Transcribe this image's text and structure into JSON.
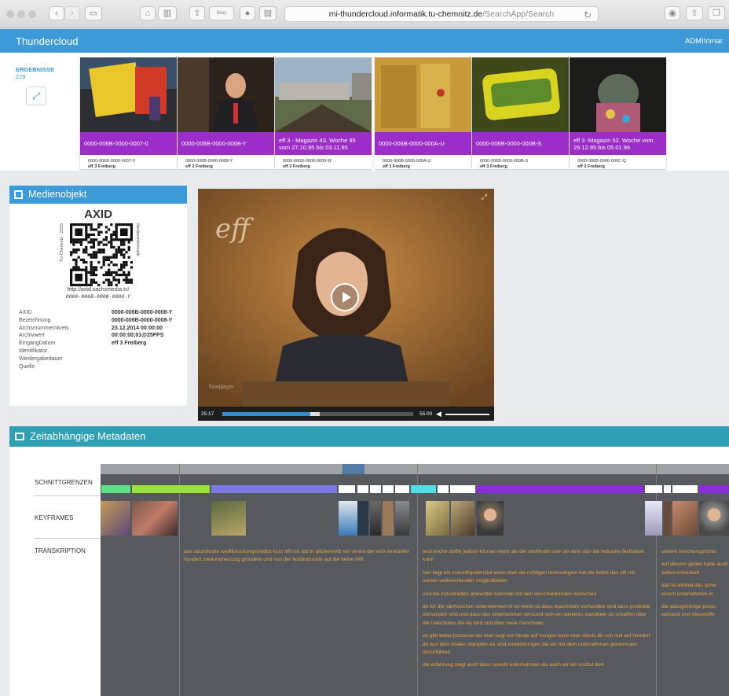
{
  "browser": {
    "url_host": "mi-thundercloud.informatik.tu-chemnitz.de",
    "url_path": "/SearchApp/Search",
    "reader_label": "ifday"
  },
  "app": {
    "name": "Thundercloud",
    "user": "ADMI\\rimar"
  },
  "results": {
    "label": "ERGEBNISSE",
    "count": "229",
    "items": [
      {
        "caption": "0000-006B-0000-0007-0",
        "id": "0000-006B-0000-0007-0",
        "station": "eff 3 Freiberg"
      },
      {
        "caption": "0000-006B-0000-0008-Y",
        "id": "0000-006B-0000-0008-Y",
        "station": "eff 3 Freiberg"
      },
      {
        "caption": "eff 3 - Magazin 43. Woche 95 vom 27.10.95 bis 03.11.95",
        "id": "0000-006B-0000-0009-W",
        "station": "eff 3 Freiberg"
      },
      {
        "caption": "0000-006B-0000-000A-U",
        "id": "0000-006B-0000-000A-U",
        "station": "eff 3 Freiberg"
      },
      {
        "caption": "0000-006B-0000-000B-S",
        "id": "0000-006B-0000-000B-S",
        "station": "eff 3 Freiberg"
      },
      {
        "caption": "eff 3 -Magazin 52. Woche vom 29.12.95 bis 05.01.96",
        "id": "0000-006B-0000-000C-Q",
        "station": "eff 3 Freiberg"
      }
    ]
  },
  "medienobjekt": {
    "title": "Medienobjekt",
    "axid_title": "AXID",
    "qr_side_left": "TU-Chemnitz - 2015",
    "qr_side_right": "Medieninformatik",
    "qr_url": "http://axid.sachsmedia.tv/",
    "qr_code": "0000-006B-0000-0008-Y",
    "props": [
      {
        "label": "AXID",
        "value": "0000-006B-0000-0008-Y"
      },
      {
        "label": "Bezeichnung",
        "value": "0000-006B-0000-0008-Y"
      },
      {
        "label": "Archivnummernkreis",
        "value": "23.12.2014 00:00:00"
      },
      {
        "label": "Archivwert",
        "value": "00:00:00;01@25FPS"
      },
      {
        "label": "EingangDatum",
        "value": "eff 3 Freiberg"
      },
      {
        "label": "Identifikator",
        "value": ""
      },
      {
        "label": "Wiedergabedauer",
        "value": ""
      },
      {
        "label": "Quelle",
        "value": ""
      }
    ]
  },
  "video": {
    "current": "25:17",
    "duration": "55:00",
    "progress": 0.46,
    "buffered_end": 0.51,
    "watermark": "flowplayer"
  },
  "metadata": {
    "title": "Zeitabhängige Metadaten",
    "rows": [
      "SCHNITTGRENZEN",
      "KEYFRAMES",
      "TRANSKRIPTION"
    ],
    "segment_colors": {
      "green1": "#5ee38a",
      "green2": "#98e23a",
      "blue": "#7a7ae6",
      "cyan": "#4fe0e6",
      "purple": "#8d2be2",
      "white": "#ffffff"
    },
    "transcript_col1": [
      "das sächsische textilforschungsinstitut kurz stfi mit sitz in altchemnitz ein verein der sich neunzehn hundert zweiundneunzig gründete und nun der textilindustrie auf die beine hilft"
    ],
    "transcript_col2": [
      "technische stoffe jedoch können mehr als der strohhalm sein an dem sich die industrie festhalten kann",
      "hier liegt ein zukunftspotenzial wenn man die richtigen technologien hat die liefert das stfi mit seinen weitreichenden möglichkeiten",
      "und die industriellen anwender kommen mit den verschiedensten wünschen",
      "äh für die sächsischen unternehmen ist es meist so dass maschinen vorhanden sind dass produkte vorhanden sind und dass das unternehmen versucht sich ein weiteres standbein zu schaffen über die maschinen die da sind und über neue maschinen",
      "es gibt keine prozesse wo man sagt von heute auf morgen kann man etwas äh von null auf hundert äh aus dem boden stampfen es sind entwicklungen die wir mit dem unternehmen gemeinsam durchführen",
      "die erfahrung zeigt auch dass sowohl unternehmen als auch wir als institut dort"
    ],
    "transcript_col3": [
      "unsere forschungsrichtu",
      "auf diesem gebiet habe auch selbst entwickelt",
      "das ist einmal das schw einem unternehmen in",
      "die dazugehörige produ verband und vliesstoffe"
    ]
  }
}
